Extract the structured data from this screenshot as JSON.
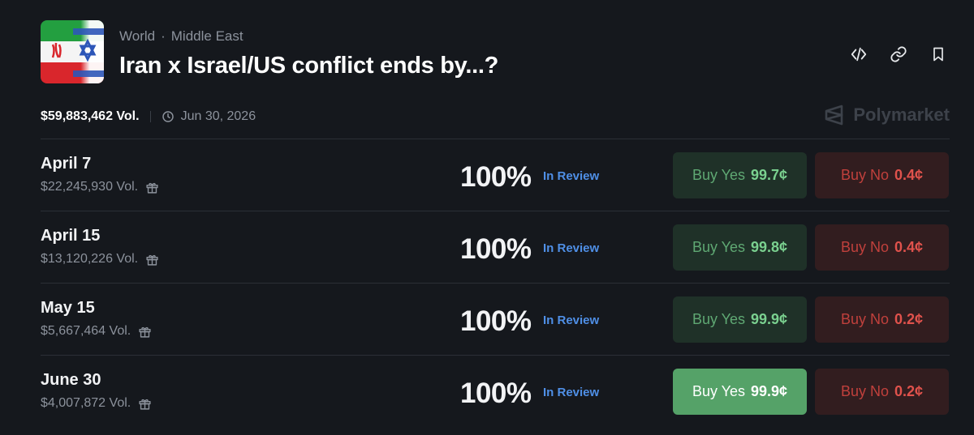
{
  "header": {
    "breadcrumbs": [
      "World",
      "Middle East"
    ],
    "breadcrumb_separator": "·",
    "title": "Iran x Israel/US conflict ends by...?"
  },
  "meta": {
    "volume": "$59,883,462 Vol.",
    "end_date": "Jun 30, 2026"
  },
  "brand": {
    "name": "Polymarket"
  },
  "outcomes": [
    {
      "label": "April 7",
      "volume": "$22,245,930 Vol.",
      "percent": "100%",
      "status": "In Review",
      "yes_label": "Buy Yes",
      "yes_price": "99.7¢",
      "no_label": "Buy No",
      "no_price": "0.4¢"
    },
    {
      "label": "April 15",
      "volume": "$13,120,226 Vol.",
      "percent": "100%",
      "status": "In Review",
      "yes_label": "Buy Yes",
      "yes_price": "99.8¢",
      "no_label": "Buy No",
      "no_price": "0.4¢"
    },
    {
      "label": "May 15",
      "volume": "$5,667,464 Vol.",
      "percent": "100%",
      "status": "In Review",
      "yes_label": "Buy Yes",
      "yes_price": "99.9¢",
      "no_label": "Buy No",
      "no_price": "0.2¢"
    },
    {
      "label": "June 30",
      "volume": "$4,007,872 Vol.",
      "percent": "100%",
      "status": "In Review",
      "yes_label": "Buy Yes",
      "yes_price": "99.9¢",
      "no_label": "Buy No",
      "no_price": "0.2¢"
    }
  ],
  "colors": {
    "background": "#15181d",
    "yes_bg": "#1f3128",
    "yes_active_bg": "#55a268",
    "no_bg": "#321d1f",
    "status_blue": "#4f8fe6"
  },
  "icons": {
    "embed": "code-icon",
    "link": "link-icon",
    "bookmark": "bookmark-icon",
    "date": "clock-icon",
    "reward": "gift-icon"
  }
}
